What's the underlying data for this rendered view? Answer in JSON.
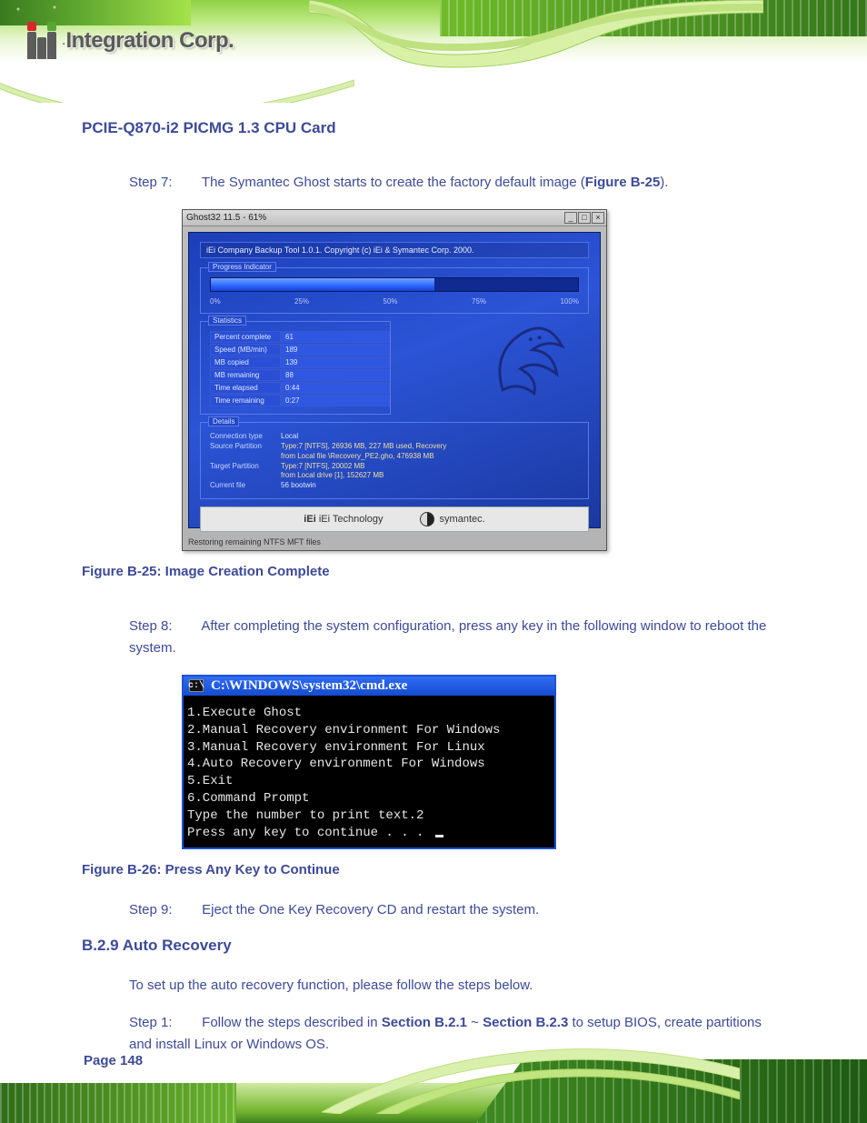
{
  "header": {
    "logo_text": "Integration Corp."
  },
  "doc": {
    "title": "PCIE-Q870-i2 PICMG 1.3 CPU Card",
    "step7_label": "Step 7:",
    "step7_text_a": "The Symantec Ghost starts to create the factory default image (",
    "step7_ref": "Figure B-25",
    "step7_text_b": ").",
    "fig25_caption": "Figure B-25: Image Creation Complete",
    "step8_label": "Step 8:",
    "step8_text_a": "After completing the system configuration, press any key in the following window to reboot the system.",
    "fig26_caption": "Figure B-26: Press Any Key to Continue",
    "step9_label": "Step 9:",
    "step9_text": "Eject the One Key Recovery CD and restart the system.",
    "section_heading": "B.2.9  Auto Recovery",
    "para1": "To set up the auto recovery function, please follow the steps below.",
    "para2_a": "Follow the steps described in ",
    "para2_ref1": "Section B.2.1",
    "para2_b": " ~ ",
    "para2_ref2": "Section B.2.3",
    "para2_c": " to setup BIOS, create partitions and install Linux or Windows OS.",
    "setup_step1_label": "Step 1:",
    "page_number": "Page 148"
  },
  "ghost": {
    "window_title": "Ghost32 11.5 - 61%",
    "copy": "iEi Company Backup Tool 1.0.1.  Copyright (c) iEi & Symantec Corp. 2000.",
    "progress_group": "Progress Indicator",
    "ticks": [
      "0%",
      "25%",
      "50%",
      "75%",
      "100%"
    ],
    "progress_percent": 61,
    "stats_group": "Statistics",
    "stats": [
      {
        "k": "Percent complete",
        "v": "61"
      },
      {
        "k": "Speed (MB/min)",
        "v": "189"
      },
      {
        "k": "MB copied",
        "v": "139"
      },
      {
        "k": "MB remaining",
        "v": "88"
      },
      {
        "k": "Time elapsed",
        "v": "0:44"
      },
      {
        "k": "Time remaining",
        "v": "0:27"
      }
    ],
    "details_group": "Details",
    "details": {
      "conn_k": "Connection type",
      "conn_v": "Local",
      "src_k": "Source Partition",
      "src_v": "Type:7 [NTFS], 26936 MB, 227 MB used, Recovery",
      "src_v2": "from Local file \\Recovery_PE2.gho, 476938 MB",
      "tgt_k": "Target Partition",
      "tgt_v": "Type:7 [NTFS], 20002 MB",
      "tgt_v2": "from Local drive [1], 152627 MB",
      "cur_k": "Current file",
      "cur_v": "56 bootwin"
    },
    "footer_iei": "iEi Technology",
    "footer_sym": "symantec.",
    "status": "Restoring remaining NTFS MFT files"
  },
  "cmd": {
    "title": "C:\\WINDOWS\\system32\\cmd.exe",
    "lines": [
      "1.Execute Ghost",
      "2.Manual Recovery environment For Windows",
      "3.Manual Recovery environment For Linux",
      "4.Auto Recovery environment For Windows",
      "5.Exit",
      "6.Command Prompt",
      "Type the number to print text.2",
      "Press any key to continue . . . "
    ]
  }
}
